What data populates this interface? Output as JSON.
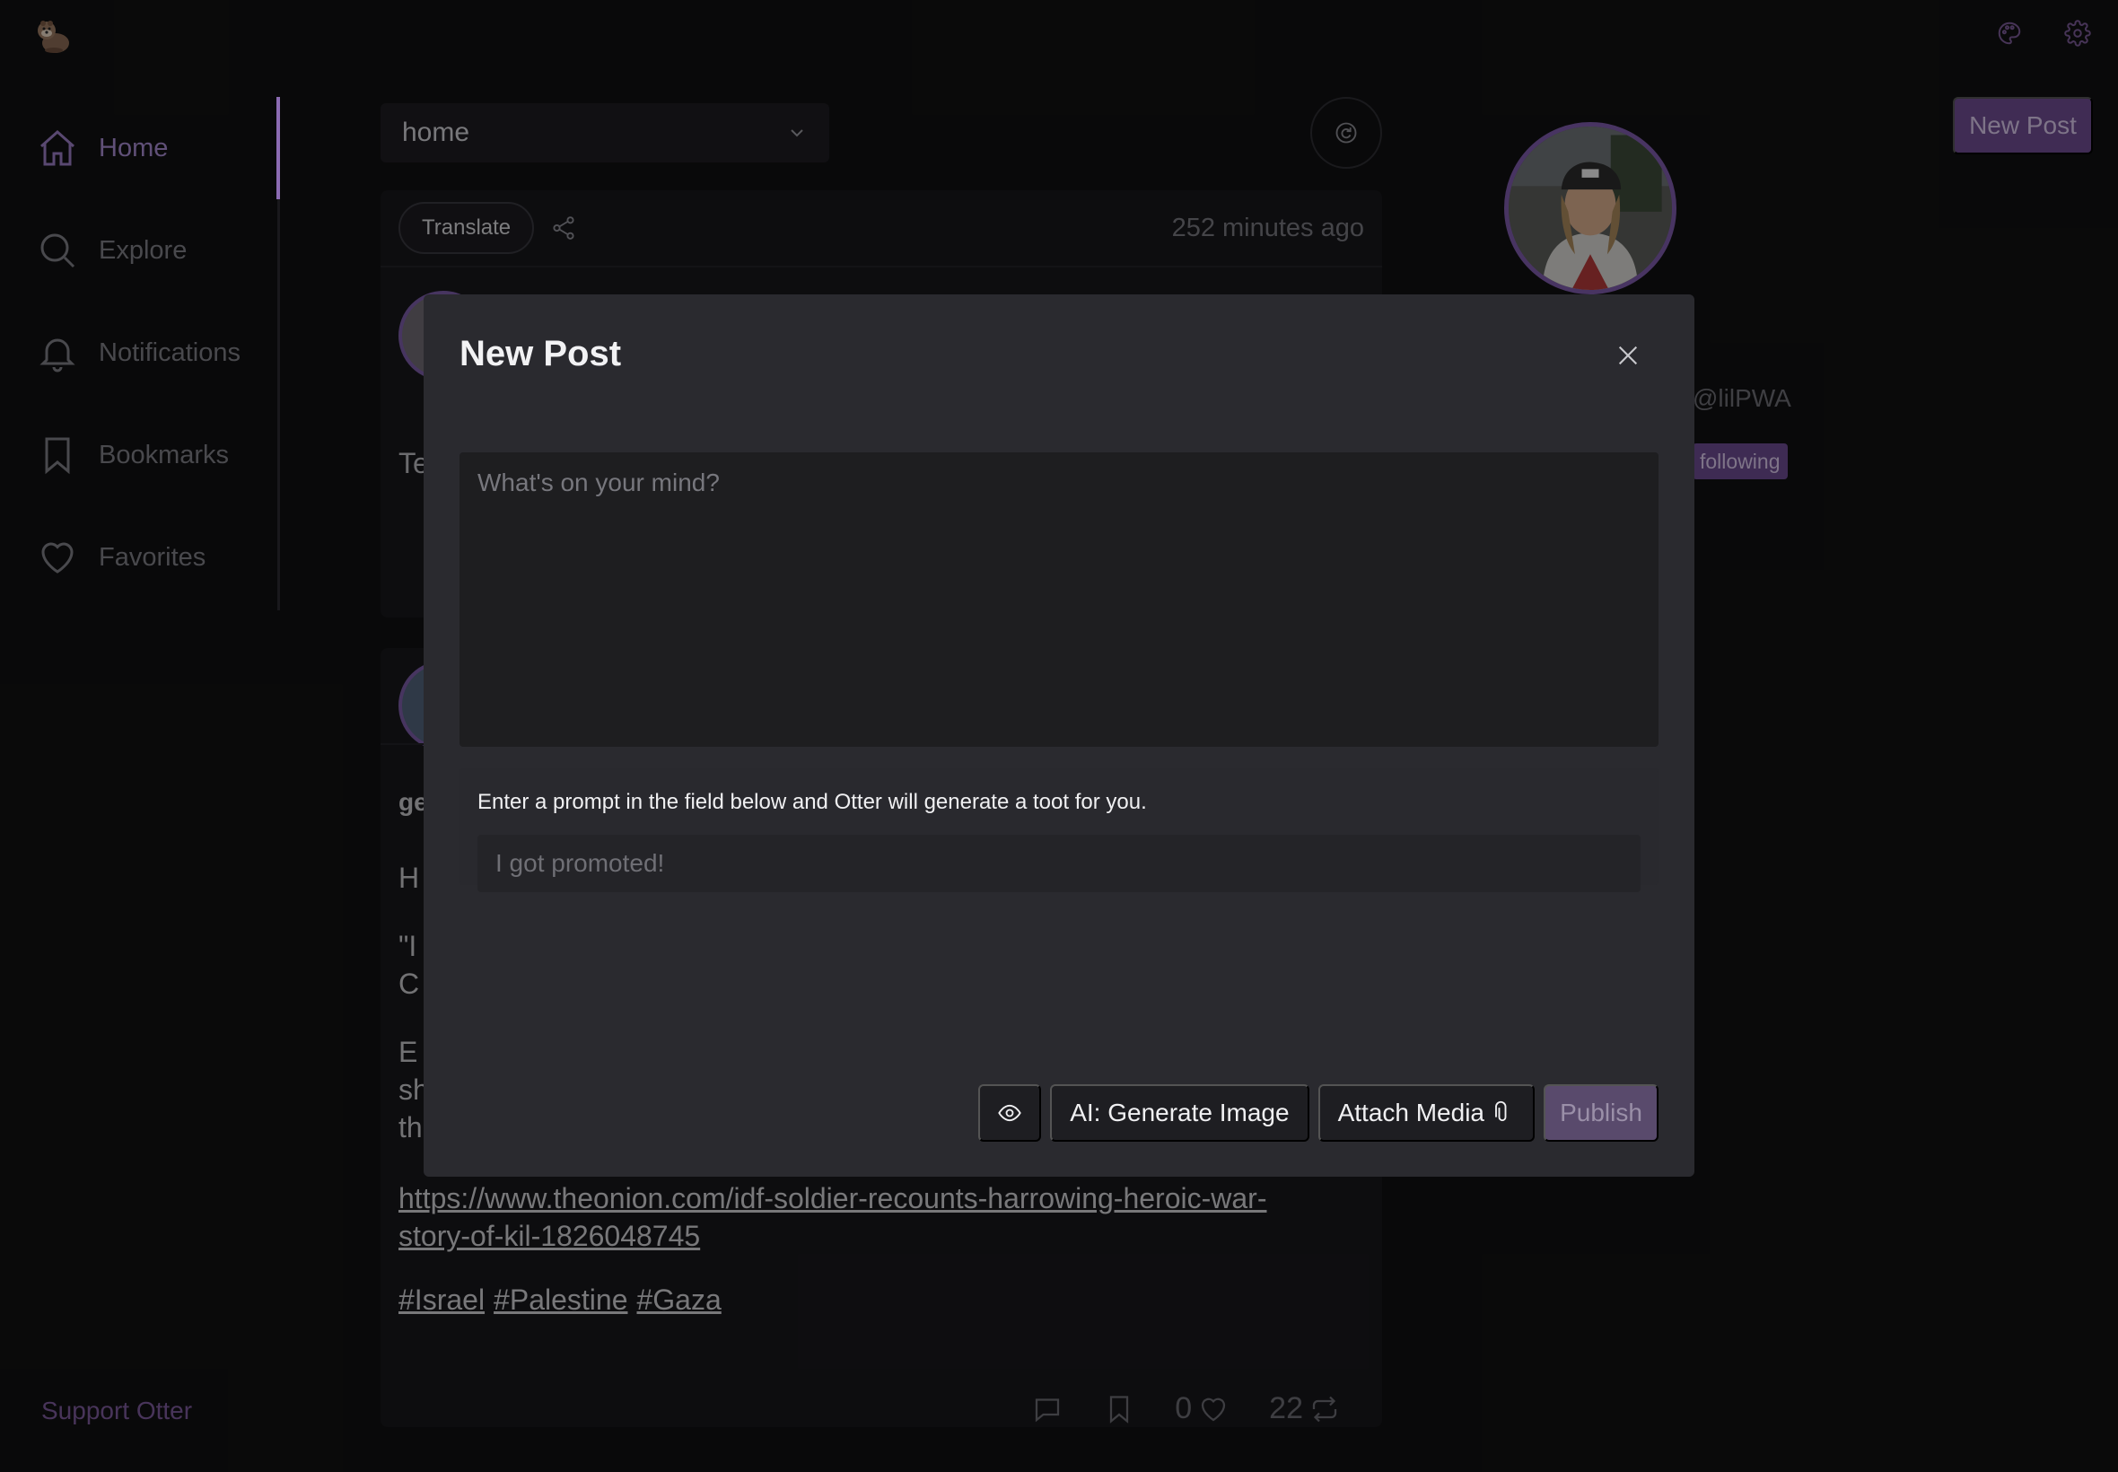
{
  "app": {
    "logo": "otter-logo"
  },
  "top_icons": [
    "palette-icon",
    "gear-icon"
  ],
  "sidebar": {
    "items": [
      {
        "label": "Home",
        "icon": "home-icon",
        "active": true
      },
      {
        "label": "Explore",
        "icon": "search-icon"
      },
      {
        "label": "Notifications",
        "icon": "bell-icon"
      },
      {
        "label": "Bookmarks",
        "icon": "bookmark-icon"
      },
      {
        "label": "Favorites",
        "icon": "heart-icon"
      }
    ],
    "support_label": "Support Otter"
  },
  "feed": {
    "selected_timeline": "home",
    "card1": {
      "translate_label": "Translate",
      "time_ago": "252 minutes ago",
      "text_fragment": "Te"
    },
    "card2": {
      "fragments": [
        "ge",
        "H",
        "\"I",
        "C",
        "E",
        "sh",
        "th"
      ],
      "link": "https://www.theonion.com/idf-soldier-recounts-harrowing-heroic-war-story-of-kil-1826048745",
      "tags": [
        "#Israel",
        "#Palestine",
        "#Gaza"
      ],
      "favorites_count": "0",
      "boosts_count": "22"
    }
  },
  "profile": {
    "new_post_label": "New Post",
    "handle": "@lilPWA",
    "following_label": "following"
  },
  "modal": {
    "title": "New Post",
    "textarea_placeholder": "What's on your mind?",
    "prompt_label": "Enter a prompt in the field below and Otter will generate a toot for you.",
    "prompt_placeholder": "I got promoted!",
    "generate_image_label": "AI: Generate Image",
    "attach_media_label": "Attach Media",
    "publish_label": "Publish"
  },
  "colors": {
    "accent": "#8b6bb3",
    "background": "#111112",
    "modal_bg": "#2a2a2f",
    "publish_disabled": "#594a6c"
  }
}
